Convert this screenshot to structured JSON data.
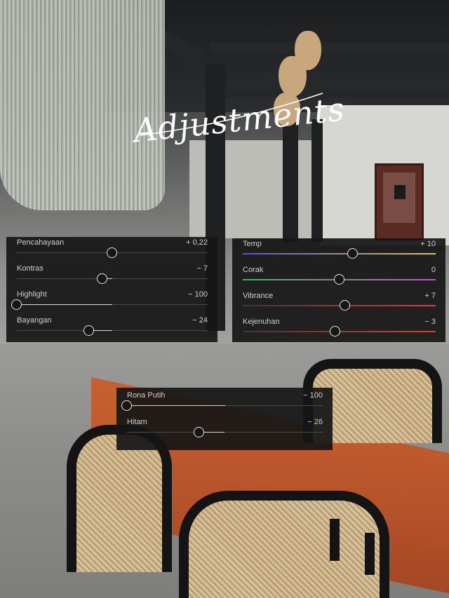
{
  "title": "Adjustments",
  "panels": {
    "light": {
      "rows": [
        {
          "label": "Pencahayaan",
          "value": "+ 0,22",
          "position": 0.5
        },
        {
          "label": "Kontras",
          "value": "− 7",
          "position": 0.45
        },
        {
          "label": "Highlight",
          "value": "− 100",
          "position": 0.0
        },
        {
          "label": "Bayangan",
          "value": "− 24",
          "position": 0.38
        }
      ]
    },
    "color": {
      "rows": [
        {
          "label": "Temp",
          "value": "+ 10",
          "position": 0.57,
          "gradient": [
            "#5a4fd8",
            "#d8c44f"
          ]
        },
        {
          "label": "Corak",
          "value": "0",
          "position": 0.5,
          "gradient": [
            "#3fb84f",
            "#c44fd0"
          ]
        },
        {
          "label": "Vibrance",
          "value": "+ 7",
          "position": 0.53,
          "gradient": [
            "#3a3a3a",
            "#e53a3a"
          ]
        },
        {
          "label": "Kejenuhan",
          "value": "− 3",
          "position": 0.48,
          "gradient": [
            "#3a3a3a",
            "#e53a3a"
          ]
        }
      ]
    },
    "tone": {
      "rows": [
        {
          "label": "Rona Putih",
          "value": "− 100",
          "position": 0.0
        },
        {
          "label": "Hitam",
          "value": "− 26",
          "position": 0.37
        }
      ]
    }
  },
  "colors": {
    "panel_bg": "#161616",
    "text": "#cfcfcf",
    "track": "#4a4a4a",
    "knob_border": "#e6e6e6"
  }
}
